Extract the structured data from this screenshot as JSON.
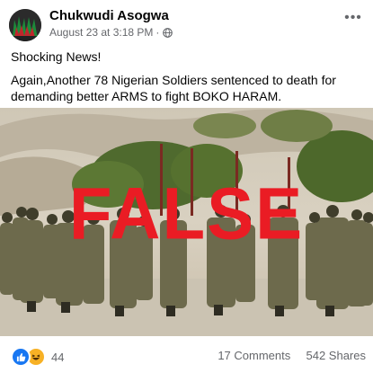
{
  "post": {
    "author": "Chukwudi Asogwa",
    "date": "August 23 at 3:18 PM",
    "separator": "·",
    "more_label": "•••",
    "headline": "Shocking News!",
    "body": "Again,Another 78 Nigerian Soldiers sentenced to death for demanding better ARMS to fight BOKO HARAM.",
    "stamp_text": "FALSE",
    "privacy_icon": "globe-icon"
  },
  "footer": {
    "reaction_count": "44",
    "comments": "17 Comments",
    "shares": "542 Shares",
    "reaction_icons": [
      "like-icon",
      "haha-icon"
    ]
  },
  "colors": {
    "stamp": "#ea1c24",
    "like": "#1877f2",
    "haha": "#f7b125",
    "meta": "#65676b"
  }
}
